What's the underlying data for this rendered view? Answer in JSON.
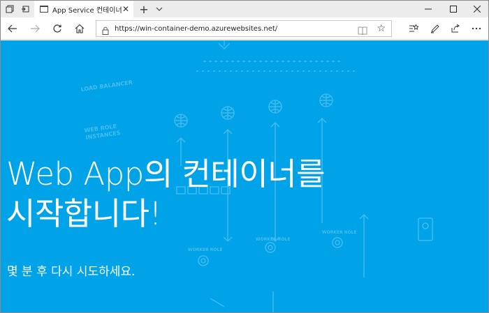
{
  "browser": {
    "tab": {
      "title": "App Service 컨테이너"
    },
    "address": {
      "url": "https://win-container-demo.azurewebsites.net/"
    }
  },
  "background_labels": {
    "load_balancer": "LOAD BALANCER",
    "web_role": "WEB ROLE",
    "instances": "INSTANCES",
    "worker_role_1": "WORKER ROLE",
    "worker_role_2": "WORKER ROLE",
    "worker_role_3": "WORKER ROLE"
  },
  "page": {
    "headline_line1": "Web App의 컨테이너를",
    "headline_line2": "시작합니다!",
    "subline": "몇 분 후 다시 시도하세요."
  },
  "colors": {
    "page_background": "#00a2e8",
    "text": "#ffffff",
    "chrome_tabbar": "#ececec"
  }
}
